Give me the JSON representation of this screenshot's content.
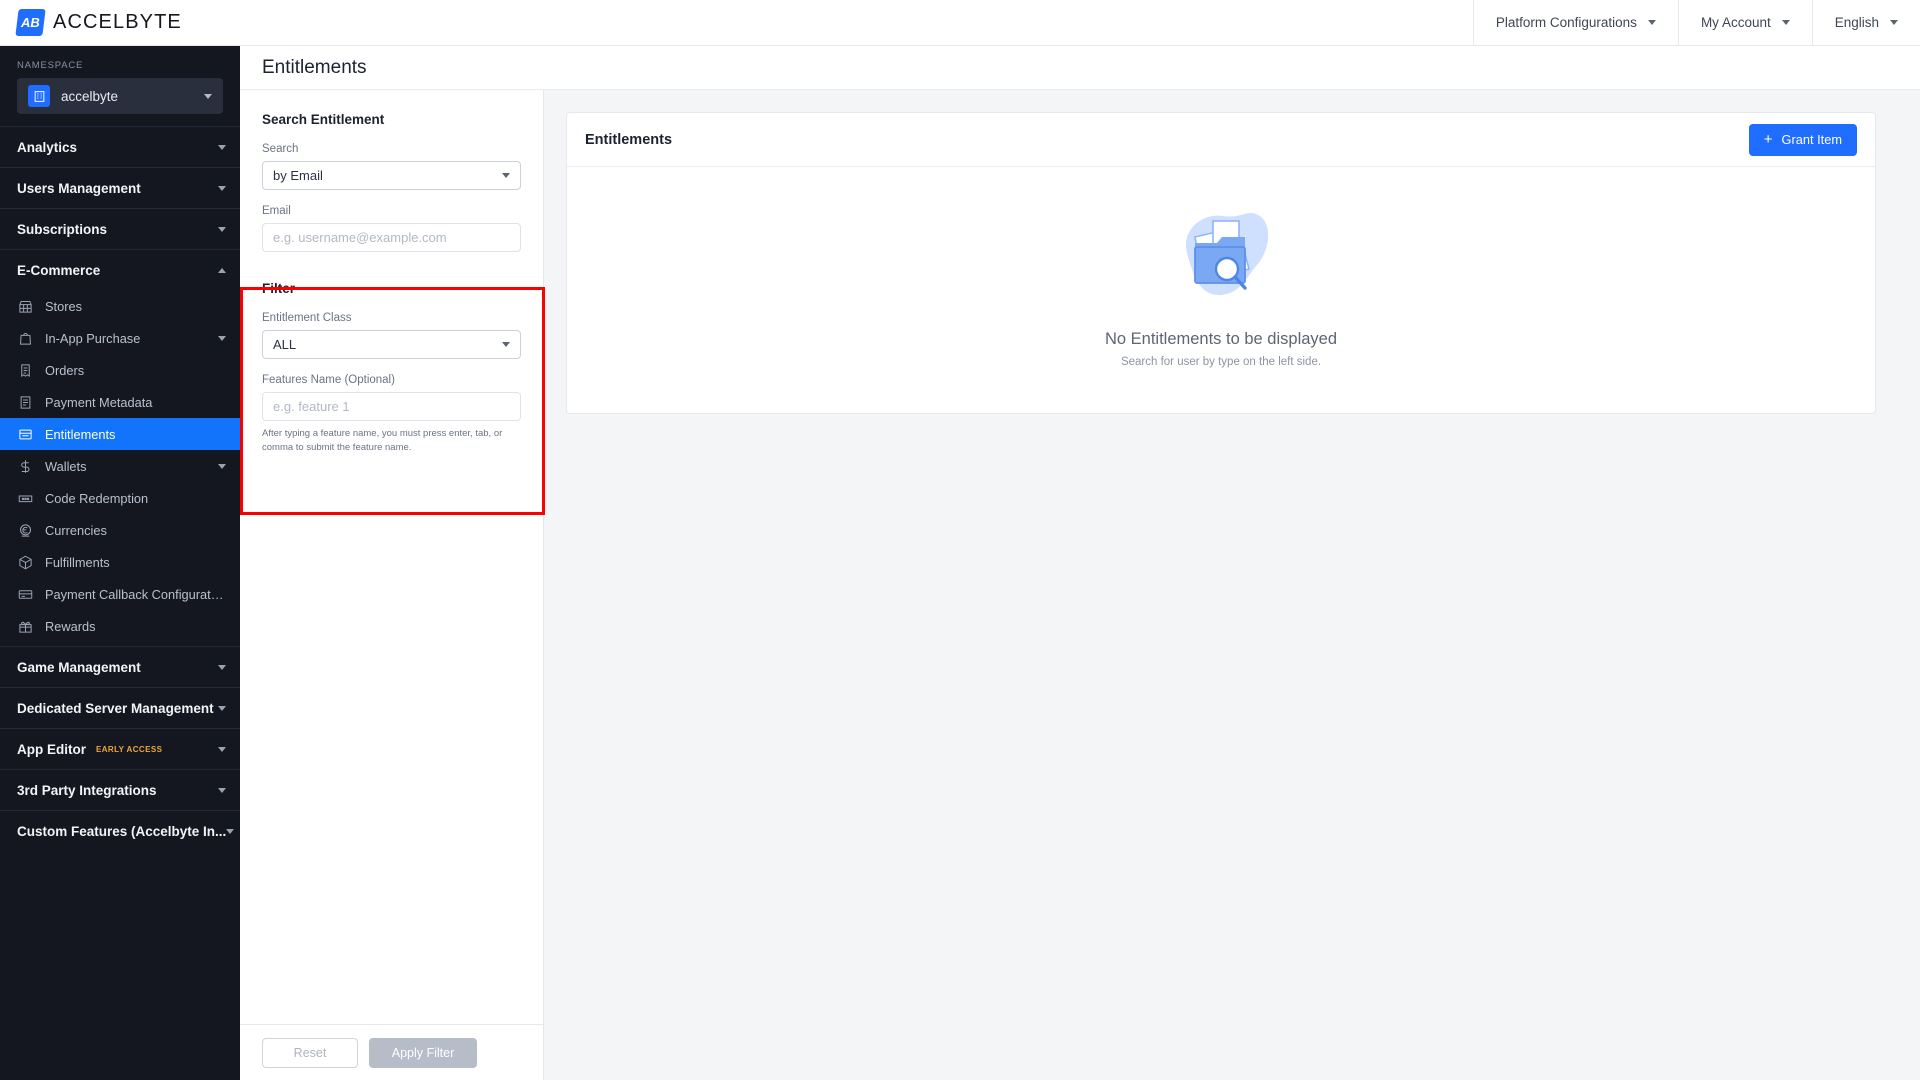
{
  "brand": {
    "name": "ACCELBYTE",
    "mark": "AB"
  },
  "topnav": [
    {
      "label": "Platform Configurations",
      "icon": "chevron-down-icon"
    },
    {
      "label": "My Account",
      "icon": "chevron-down-icon"
    },
    {
      "label": "English",
      "icon": "chevron-down-icon"
    }
  ],
  "namespace": {
    "label": "NAMESPACE",
    "value": "accelbyte",
    "icon": "building-icon"
  },
  "sidebar": {
    "sections": [
      {
        "title": "Analytics",
        "collapsible": true,
        "expanded": false,
        "items": []
      },
      {
        "title": "Users Management",
        "collapsible": true,
        "expanded": false,
        "items": []
      },
      {
        "title": "Subscriptions",
        "collapsible": true,
        "expanded": false,
        "items": []
      },
      {
        "title": "E-Commerce",
        "collapsible": true,
        "expanded": true,
        "items": [
          {
            "label": "Stores",
            "icon": "store-icon",
            "active": false,
            "chevron": false
          },
          {
            "label": "In-App Purchase",
            "icon": "bag-icon",
            "active": false,
            "chevron": true
          },
          {
            "label": "Orders",
            "icon": "receipt-icon",
            "active": false,
            "chevron": false
          },
          {
            "label": "Payment Metadata",
            "icon": "document-icon",
            "active": false,
            "chevron": false
          },
          {
            "label": "Entitlements",
            "icon": "entitlement-icon",
            "active": true,
            "chevron": false
          },
          {
            "label": "Wallets",
            "icon": "dollar-icon",
            "active": false,
            "chevron": true
          },
          {
            "label": "Code Redemption",
            "icon": "code-icon",
            "active": false,
            "chevron": false
          },
          {
            "label": "Currencies",
            "icon": "currency-icon",
            "active": false,
            "chevron": false
          },
          {
            "label": "Fulfillments",
            "icon": "box-icon",
            "active": false,
            "chevron": false
          },
          {
            "label": "Payment Callback Configuration",
            "icon": "card-icon",
            "active": false,
            "chevron": false
          },
          {
            "label": "Rewards",
            "icon": "gift-icon",
            "active": false,
            "chevron": false
          }
        ]
      },
      {
        "title": "Game Management",
        "collapsible": true,
        "expanded": false,
        "items": []
      },
      {
        "title": "Dedicated Server Management",
        "collapsible": true,
        "expanded": false,
        "items": []
      },
      {
        "title": "App Editor",
        "badge": "EARLY ACCESS",
        "collapsible": true,
        "expanded": false,
        "items": []
      },
      {
        "title": "3rd Party Integrations",
        "collapsible": true,
        "expanded": false,
        "items": []
      },
      {
        "title": "Custom Features (Accelbyte In...",
        "collapsible": true,
        "expanded": false,
        "items": []
      }
    ]
  },
  "page": {
    "title": "Entitlements"
  },
  "search_panel": {
    "title": "Search Entitlement",
    "search_label": "Search",
    "search_value": "by Email",
    "email_label": "Email",
    "email_value": "",
    "email_placeholder": "e.g. username@example.com"
  },
  "filter_panel": {
    "title": "Filter",
    "class_label": "Entitlement Class",
    "class_value": "ALL",
    "features_label": "Features Name (Optional)",
    "features_value": "",
    "features_placeholder": "e.g. feature 1",
    "hint": "After typing a feature name, you must press enter, tab, or comma to submit the feature name.",
    "highlight_color": "#fc0000"
  },
  "footer_buttons": {
    "reset": "Reset",
    "apply": "Apply Filter"
  },
  "entitlements_card": {
    "title": "Entitlements",
    "grant_button": "Grant Item",
    "grant_icon": "plus-icon",
    "empty_title": "No Entitlements to be displayed",
    "empty_subtitle": "Search for user by type on the left side.",
    "empty_icon": "folder-search-icon"
  },
  "colors": {
    "accent": "#1f6eff",
    "sidebar": "#14171f",
    "active_item": "#1273fb",
    "badge": "#f0a53a"
  }
}
